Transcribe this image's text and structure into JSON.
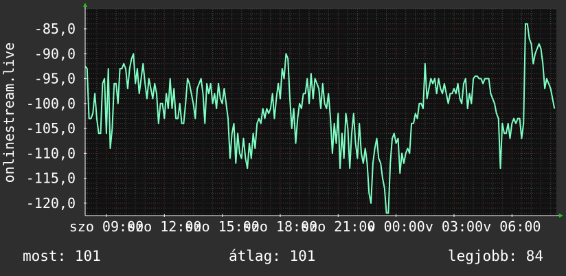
{
  "chart_data": {
    "type": "line",
    "ylabel": "onlinestream.live",
    "ylim": [
      -122.5,
      -81.0
    ],
    "y_ticks": [
      "-85,0",
      "-90,0",
      "-95,0",
      "-100,0",
      "-105,0",
      "-110,0",
      "-115,0",
      "-120,0"
    ],
    "y_tick_values": [
      -85,
      -90,
      -95,
      -100,
      -105,
      -110,
      -115,
      -120
    ],
    "x_ticks": [
      "szo 09:00",
      "szo 12:00",
      "szo 15:00",
      "szo 18:00",
      "szo 21:00",
      "v 00:00",
      "v 03:00",
      "v 06:00"
    ],
    "x_tick_hours": [
      9,
      12,
      15,
      18,
      21,
      24,
      27,
      30
    ],
    "xlim_hours": [
      7.9,
      32.3
    ],
    "grid": true,
    "series": [
      {
        "color": "#7fffc4",
        "x_hours": [
          7.9,
          8.0,
          8.1,
          8.2,
          8.3,
          8.4,
          8.5,
          8.6,
          8.7,
          8.8,
          8.9,
          9.0,
          9.1,
          9.2,
          9.3,
          9.4,
          9.5,
          9.6,
          9.7,
          9.8,
          9.9,
          10.0,
          10.1,
          10.2,
          10.3,
          10.4,
          10.5,
          10.6,
          10.7,
          10.8,
          10.9,
          11.0,
          11.1,
          11.2,
          11.3,
          11.4,
          11.5,
          11.6,
          11.7,
          11.8,
          11.9,
          12.0,
          12.1,
          12.2,
          12.3,
          12.4,
          12.5,
          12.6,
          12.7,
          12.8,
          12.9,
          13.0,
          13.1,
          13.2,
          13.3,
          13.4,
          13.5,
          13.6,
          13.7,
          13.8,
          13.9,
          14.0,
          14.1,
          14.2,
          14.3,
          14.4,
          14.5,
          14.6,
          14.7,
          14.8,
          14.9,
          15.0,
          15.1,
          15.2,
          15.3,
          15.4,
          15.5,
          15.6,
          15.7,
          15.8,
          15.9,
          16.0,
          16.1,
          16.2,
          16.3,
          16.4,
          16.5,
          16.6,
          16.7,
          16.8,
          16.9,
          17.0,
          17.1,
          17.2,
          17.3,
          17.4,
          17.5,
          17.6,
          17.7,
          17.8,
          17.9,
          18.0,
          18.1,
          18.2,
          18.3,
          18.4,
          18.5,
          18.6,
          18.7,
          18.8,
          18.9,
          19.0,
          19.1,
          19.2,
          19.3,
          19.4,
          19.5,
          19.6,
          19.7,
          19.8,
          19.9,
          20.0,
          20.1,
          20.2,
          20.3,
          20.4,
          20.5,
          20.6,
          20.7,
          20.8,
          20.9,
          21.0,
          21.1,
          21.2,
          21.3,
          21.4,
          21.5,
          21.6,
          21.7,
          21.8,
          21.9,
          22.0,
          22.1,
          22.2,
          22.3,
          22.4,
          22.5,
          22.6,
          22.7,
          22.8,
          22.9,
          23.0,
          23.1,
          23.2,
          23.3,
          23.4,
          23.5,
          23.6,
          23.7,
          23.8,
          23.9,
          24.0,
          24.1,
          24.2,
          24.3,
          24.4,
          24.5,
          24.6,
          24.7,
          24.8,
          24.9,
          25.0,
          25.1,
          25.2,
          25.3,
          25.4,
          25.5,
          25.6,
          25.7,
          25.8,
          25.9,
          26.0,
          26.1,
          26.2,
          26.3,
          26.4,
          26.5,
          26.6,
          26.7,
          26.8,
          26.9,
          27.0,
          27.1,
          27.2,
          27.3,
          27.4,
          27.5,
          27.6,
          27.7,
          27.8,
          27.9,
          28.0,
          28.1,
          28.2,
          28.3,
          28.4,
          28.5,
          28.6,
          28.7,
          28.8,
          28.9,
          29.0,
          29.1,
          29.2,
          29.3,
          29.4,
          29.5,
          29.6,
          29.7,
          29.8,
          29.9,
          30.0,
          30.1,
          30.2,
          30.3,
          30.4,
          30.5,
          30.6,
          30.7,
          30.8,
          30.9,
          31.0,
          31.1,
          31.2,
          31.3,
          31.4,
          31.5,
          31.6,
          31.7,
          31.8,
          31.9,
          32.0,
          32.1,
          32.2
        ],
        "values": [
          -92.5,
          -93,
          -103,
          -103,
          -102,
          -98,
          -103,
          -106,
          -106,
          -96,
          -95,
          -106,
          -93,
          -109,
          -105,
          -96,
          -96,
          -100,
          -93,
          -93,
          -92,
          -93,
          -97,
          -93,
          -91,
          -90,
          -96,
          -93,
          -98,
          -95,
          -92,
          -96,
          -99,
          -95,
          -97,
          -99,
          -96,
          -98,
          -104,
          -100,
          -100,
          -103,
          -98,
          -101,
          -95,
          -101,
          -97,
          -103,
          -103,
          -100,
          -104,
          -104,
          -100,
          -95,
          -96,
          -98,
          -100,
          -103,
          -97,
          -96,
          -95,
          -98,
          -104,
          -96,
          -98,
          -96,
          -100,
          -98,
          -101,
          -96,
          -99,
          -100,
          -97,
          -100,
          -103,
          -111,
          -106,
          -104,
          -112,
          -106,
          -110,
          -111,
          -107,
          -111,
          -113,
          -108,
          -111,
          -106,
          -109,
          -104,
          -103,
          -104,
          -101,
          -103,
          -101,
          -102,
          -101,
          -98,
          -103,
          -99,
          -96,
          -99,
          -93,
          -95,
          -90,
          -91,
          -99,
          -105,
          -101,
          -108,
          -103,
          -100,
          -101,
          -98,
          -98,
          -95,
          -100,
          -94,
          -99,
          -95,
          -96,
          -97,
          -101,
          -96,
          -100,
          -101,
          -98,
          -103,
          -110,
          -104,
          -108,
          -102,
          -113,
          -106,
          -111,
          -102,
          -105,
          -113,
          -106,
          -102,
          -108,
          -111,
          -104,
          -110,
          -112,
          -109,
          -112,
          -118,
          -120,
          -112,
          -109,
          -107,
          -111,
          -112,
          -115,
          -117,
          -122,
          -122,
          -112,
          -107,
          -106,
          -108,
          -107,
          -114,
          -110,
          -112,
          -110,
          -109,
          -110,
          -104,
          -104,
          -102,
          -103,
          -100,
          -100,
          -101,
          -92,
          -99,
          -97,
          -95,
          -96,
          -95,
          -98,
          -95,
          -97,
          -98,
          -96,
          -98,
          -100,
          -98,
          -98,
          -97,
          -98,
          -96,
          -99,
          -100,
          -96,
          -95,
          -101,
          -98,
          -100,
          -95,
          -94.5,
          -94.5,
          -95,
          -95,
          -96,
          -95,
          -95,
          -95,
          -98,
          -99,
          -100,
          -102,
          -103,
          -113,
          -104,
          -106,
          -106,
          -104,
          -107,
          -104,
          -103,
          -104,
          -103,
          -103,
          -107,
          -104,
          -84,
          -84,
          -87,
          -88,
          -92,
          -90,
          -89,
          -88,
          -89,
          -92,
          -97,
          -95,
          -96,
          -97,
          -99,
          -101
        ]
      }
    ],
    "current_label": "most: 101",
    "average_label": "átlag: 101",
    "best_label": "legjobb: 84"
  },
  "colors": {
    "background": "#2e2e2e",
    "plot_background": "#111111",
    "grid_minor": "#454545",
    "grid_major": "#6a2d2d",
    "axis": "#ffffff",
    "arrow": "#22c422",
    "line": "#7fffc4"
  }
}
